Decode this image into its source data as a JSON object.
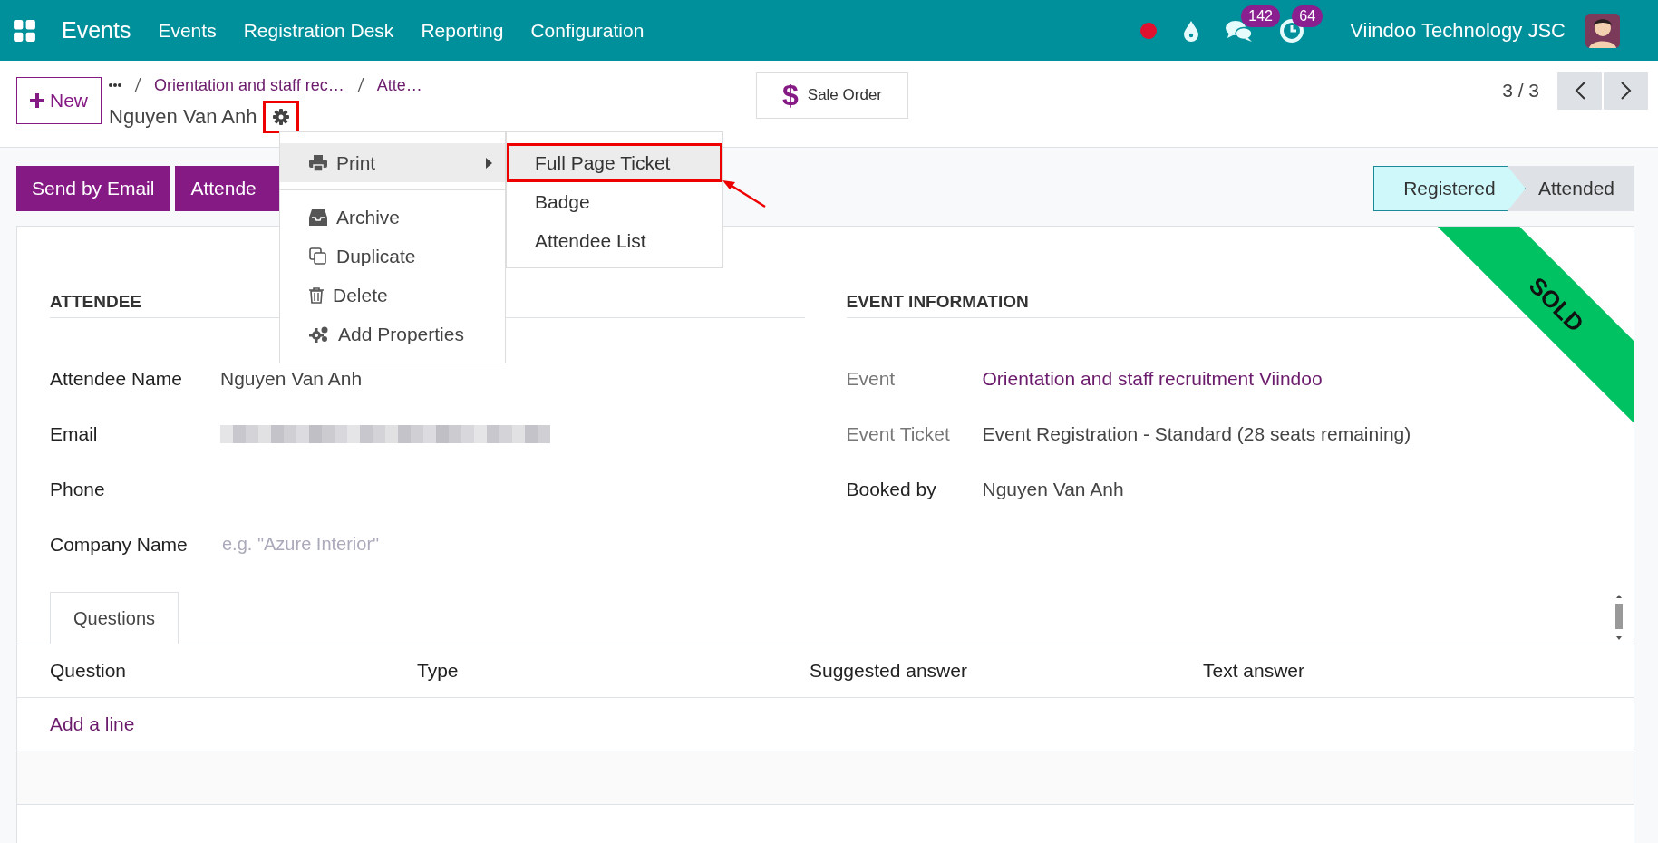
{
  "navbar": {
    "app_name": "Events",
    "menus": [
      "Events",
      "Registration Desk",
      "Reporting",
      "Configuration"
    ],
    "chat_count": "142",
    "activity_count": "64",
    "company": "Viindoo Technology JSC"
  },
  "control_panel": {
    "new_button": "New",
    "breadcrumbs": [
      "Orientation and staff rec…",
      "Atte…"
    ],
    "record_title": "Nguyen Van Anh",
    "smart_button_icon": "$",
    "smart_button": "Sale Order",
    "pager": "3 / 3"
  },
  "action_menu": [
    {
      "kind": "submenu",
      "label": "Print",
      "selected": true
    },
    {
      "kind": "divider"
    },
    {
      "kind": "action",
      "label": "Archive",
      "selected": false
    },
    {
      "kind": "action",
      "label": "Duplicate",
      "selected": false
    },
    {
      "kind": "action",
      "label": "Delete",
      "selected": false
    },
    {
      "kind": "action",
      "label": "Add Properties",
      "selected": false
    }
  ],
  "print_submenu": [
    {
      "label": "Full Page Ticket",
      "selected": true
    },
    {
      "label": "Badge",
      "selected": false
    },
    {
      "label": "Attendee List",
      "selected": false
    }
  ],
  "header_buttons": [
    "Send by Email",
    "Attende"
  ],
  "status_bar": [
    {
      "label": "Registered",
      "selected": true
    },
    {
      "label": "Attended",
      "selected": false
    }
  ],
  "ribbon": "SOLD",
  "attendee": {
    "title": "ATTENDEE",
    "fields": [
      {
        "label": "Attendee Name",
        "kind": "text",
        "value": "Nguyen Van Anh"
      },
      {
        "label": "Email",
        "kind": "blurred"
      },
      {
        "label": "Phone",
        "kind": "empty"
      },
      {
        "label": "Company Name",
        "kind": "input",
        "placeholder": "e.g. \"Azure Interior\""
      }
    ]
  },
  "event_information": {
    "title": "EVENT INFORMATION",
    "fields": [
      {
        "label": "Event",
        "kind": "link",
        "value": "Orientation and staff recruitment Viindoo",
        "disabled": true
      },
      {
        "label": "Event Ticket",
        "kind": "text",
        "value": "Event Registration - Standard (28 seats remaining)",
        "disabled": true
      },
      {
        "label": "Booked by",
        "kind": "text",
        "value": "Nguyen Van Anh",
        "disabled": false
      }
    ]
  },
  "tabs": [
    {
      "label": "Questions",
      "selected": true
    }
  ],
  "table": {
    "columns": [
      "Question",
      "Type",
      "Suggested answer",
      "Text answer"
    ],
    "add_line": "Add a line"
  }
}
